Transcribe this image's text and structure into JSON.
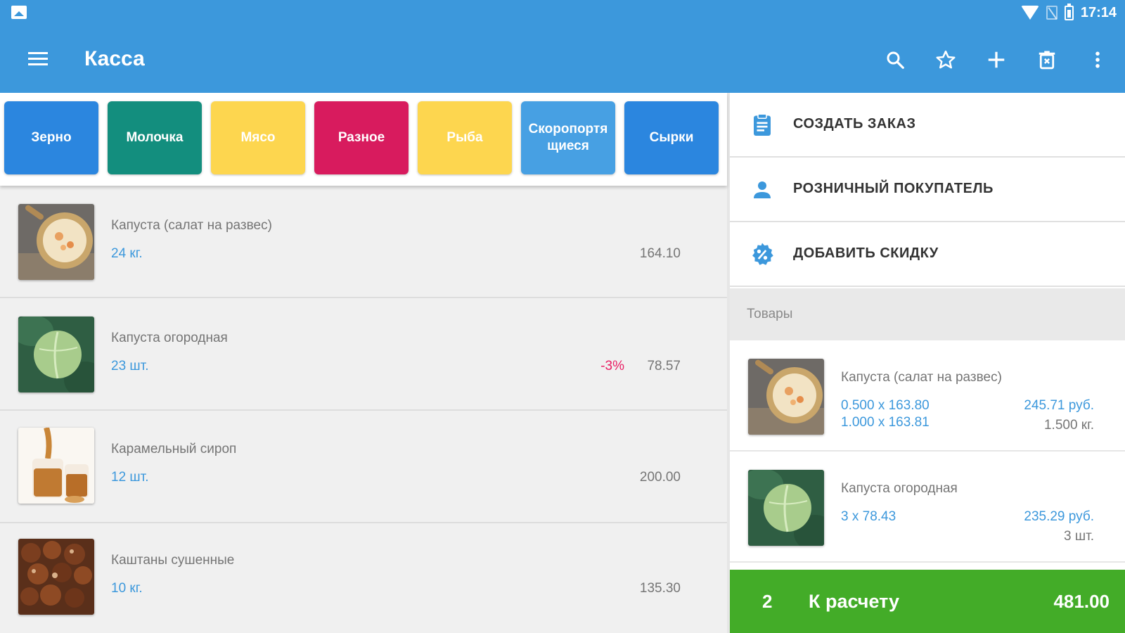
{
  "status_bar": {
    "time": "17:14"
  },
  "app_bar": {
    "title": "Касса",
    "actions": [
      "search-icon",
      "star-icon",
      "add-icon",
      "delete-icon",
      "more-vert-icon"
    ]
  },
  "categories": [
    {
      "label": "Зерно",
      "color": "#2b86df"
    },
    {
      "label": "Молочка",
      "color": "#138e7e"
    },
    {
      "label": "Мясо",
      "color": "#fdd64f"
    },
    {
      "label": "Разное",
      "color": "#d81b5e"
    },
    {
      "label": "Рыба",
      "color": "#fdd64f"
    },
    {
      "label": "Скоропортя щиеся",
      "color": "#47a0e3"
    },
    {
      "label": "Сырки",
      "color": "#2b86df"
    }
  ],
  "products": [
    {
      "name": "Капуста (салат на развес)",
      "qty": "24 кг.",
      "discount": "",
      "price": "164.10"
    },
    {
      "name": "Капуста огородная",
      "qty": "23 шт.",
      "discount": "-3%",
      "price": "78.57"
    },
    {
      "name": "Карамельный сироп",
      "qty": "12 шт.",
      "discount": "",
      "price": "200.00"
    },
    {
      "name": "Каштаны сушенные",
      "qty": "10 кг.",
      "discount": "",
      "price": "135.30"
    }
  ],
  "right_panel": {
    "actions": [
      {
        "label": "СОЗДАТЬ ЗАКАЗ",
        "icon": "clipboard-icon"
      },
      {
        "label": "РОЗНИЧНЫЙ ПОКУПАТЕЛЬ",
        "icon": "person-icon"
      },
      {
        "label": "ДОБАВИТЬ СКИДКУ",
        "icon": "percent-icon"
      }
    ],
    "section_title": "Товары",
    "cart": [
      {
        "name": "Капуста (салат на развес)",
        "line1": "0.500 x 163.80",
        "line2": "1.000 x 163.81",
        "sum": "245.71 руб.",
        "qty": "1.500 кг."
      },
      {
        "name": "Капуста огородная",
        "line1": "3 x 78.43",
        "line2": "",
        "sum": "235.29 руб.",
        "qty": "3 шт."
      }
    ],
    "pay": {
      "count": "2",
      "label": "К расчету",
      "total": "481.00"
    }
  },
  "colors": {
    "primary": "#3c98dc",
    "accent_green": "#43ac28",
    "discount": "#e91e63"
  }
}
